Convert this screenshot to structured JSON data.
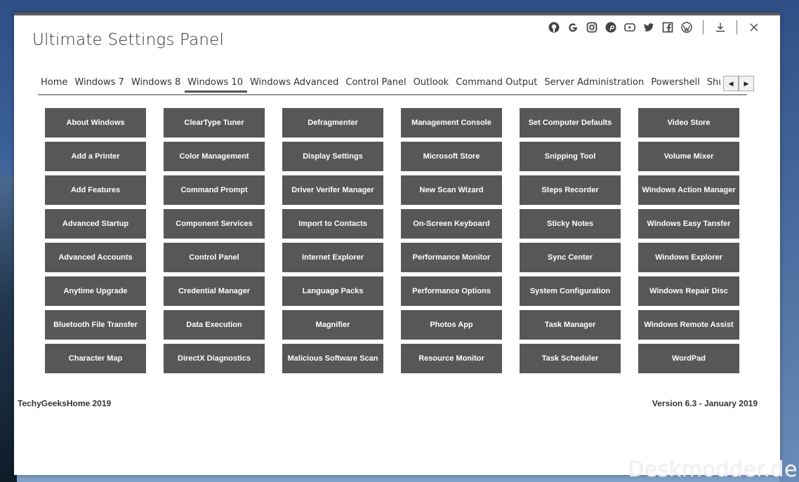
{
  "app": {
    "title": "Ultimate Settings Panel"
  },
  "titlebar": {
    "icons": [
      "github-icon",
      "google-icon",
      "instagram-icon",
      "pinterest-icon",
      "youtube-icon",
      "twitter-icon",
      "facebook-icon",
      "wordpress-icon"
    ],
    "download_icon": "download-icon",
    "close_icon": "close-icon"
  },
  "tabs": [
    {
      "label": "Home"
    },
    {
      "label": "Windows 7"
    },
    {
      "label": "Windows 8"
    },
    {
      "label": "Windows 10"
    },
    {
      "label": "Windows Advanced"
    },
    {
      "label": "Control Panel"
    },
    {
      "label": "Outlook"
    },
    {
      "label": "Command Output"
    },
    {
      "label": "Server Administration"
    },
    {
      "label": "Powershell"
    },
    {
      "label": "Shutdown Options"
    }
  ],
  "active_tab": "Windows 10",
  "scroll": {
    "left": "◀",
    "right": "▶"
  },
  "buttons": [
    "About Windows",
    "ClearType Tuner",
    "Defragmenter",
    "Management Console",
    "Set Computer Defaults",
    "Video Store",
    "Add a Printer",
    "Color Management",
    "Display Settings",
    "Microsoft Store",
    "Snipping Tool",
    "Volume Mixer",
    "Add Features",
    "Command Prompt",
    "Driver Verifer Manager",
    "New Scan Wizard",
    "Steps Recorder",
    "Windows Action Manager",
    "Advanced Startup",
    "Component Services",
    "Import to Contacts",
    "On-Screen Keyboard",
    "Sticky Notes",
    "Windows Easy Tansfer",
    "Advanced Accounts",
    "Control Panel",
    "Internet Explorer",
    "Performance Monitor",
    "Sync Center",
    "Windows Explorer",
    "Anytime Upgrade",
    "Credential Manager",
    "Language Packs",
    "Performance Options",
    "System Configuration",
    "Windows Repair Disc",
    "Bluetooth File Transfer",
    "Data Execution",
    "Magnifier",
    "Photos App",
    "Task Manager",
    "Windows Remote Assist",
    "Character Map",
    "DirectX Diagnostics",
    "Malicious Software Scan",
    "Resource Monitor",
    "Task Scheduler",
    "WordPad"
  ],
  "footer": {
    "left": "TechyGeeksHome 2019",
    "right": "Version 6.3 - January 2019"
  },
  "watermark": "Deskmodder.de",
  "colors": {
    "button_bg": "#575757",
    "button_text": "#ffffff",
    "window_bg": "#ffffff"
  }
}
